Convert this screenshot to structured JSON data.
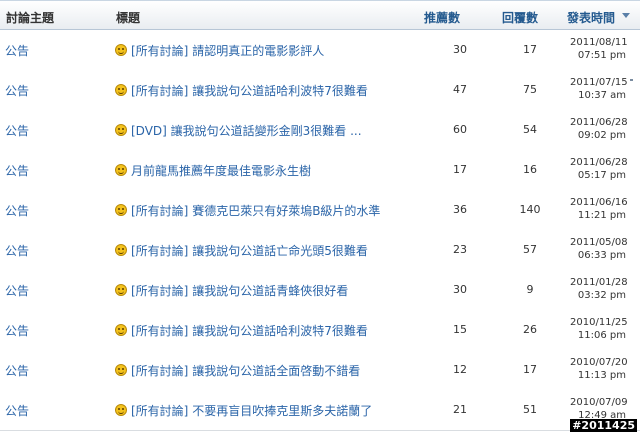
{
  "headers": {
    "forum": "討論主題",
    "title": "標題",
    "recommend": "推薦數",
    "replies": "回覆數",
    "posted": "發表時間"
  },
  "rows": [
    {
      "forum": "公告",
      "category": "[所有討論]",
      "title": "請認明真正的電影影評人",
      "recommend": "30",
      "replies": "17",
      "date": "2011/08/11",
      "time": "07:51 pm"
    },
    {
      "forum": "公告",
      "category": "[所有討論]",
      "title": "讓我說句公道話哈利波特7很難看",
      "recommend": "47",
      "replies": "75",
      "date": "2011/07/15",
      "time": "10:37 am"
    },
    {
      "forum": "公告",
      "category": "[DVD]",
      "title": "讓我說句公道話變形金剛3很難看 ...",
      "recommend": "60",
      "replies": "54",
      "date": "2011/06/28",
      "time": "09:02 pm"
    },
    {
      "forum": "公告",
      "category": "",
      "title": "月前龍馬推薦年度最佳電影永生樹",
      "recommend": "17",
      "replies": "16",
      "date": "2011/06/28",
      "time": "05:17 pm"
    },
    {
      "forum": "公告",
      "category": "[所有討論]",
      "title": "賽德克巴萊只有好萊塢B級片的水準",
      "recommend": "36",
      "replies": "140",
      "date": "2011/06/16",
      "time": "11:21 pm"
    },
    {
      "forum": "公告",
      "category": "[所有討論]",
      "title": "讓我說句公道話亡命光頭5很難看",
      "recommend": "23",
      "replies": "57",
      "date": "2011/05/08",
      "time": "06:33 pm"
    },
    {
      "forum": "公告",
      "category": "[所有討論]",
      "title": "讓我說句公道話青蜂俠很好看",
      "recommend": "30",
      "replies": "9",
      "date": "2011/01/28",
      "time": "03:32 pm"
    },
    {
      "forum": "公告",
      "category": "[所有討論]",
      "title": "讓我說句公道話哈利波特7很難看",
      "recommend": "15",
      "replies": "26",
      "date": "2010/11/25",
      "time": "11:06 pm"
    },
    {
      "forum": "公告",
      "category": "[所有討論]",
      "title": "讓我說句公道話全面啓動不錯看",
      "recommend": "12",
      "replies": "17",
      "date": "2010/07/20",
      "time": "11:13 pm"
    },
    {
      "forum": "公告",
      "category": "[所有討論]",
      "title": "不要再盲目吹捧克里斯多夫諾蘭了",
      "recommend": "21",
      "replies": "51",
      "date": "2010/07/09",
      "time": "12:49 am"
    }
  ],
  "watermark": "#2011425",
  "colors": {
    "link": "#2a64a8",
    "header_sort": "#245a8f",
    "row_border": "#d9dde1"
  },
  "icons": {
    "row_icon": "smiley-icon",
    "sort_indicator": "sort-down-icon"
  }
}
